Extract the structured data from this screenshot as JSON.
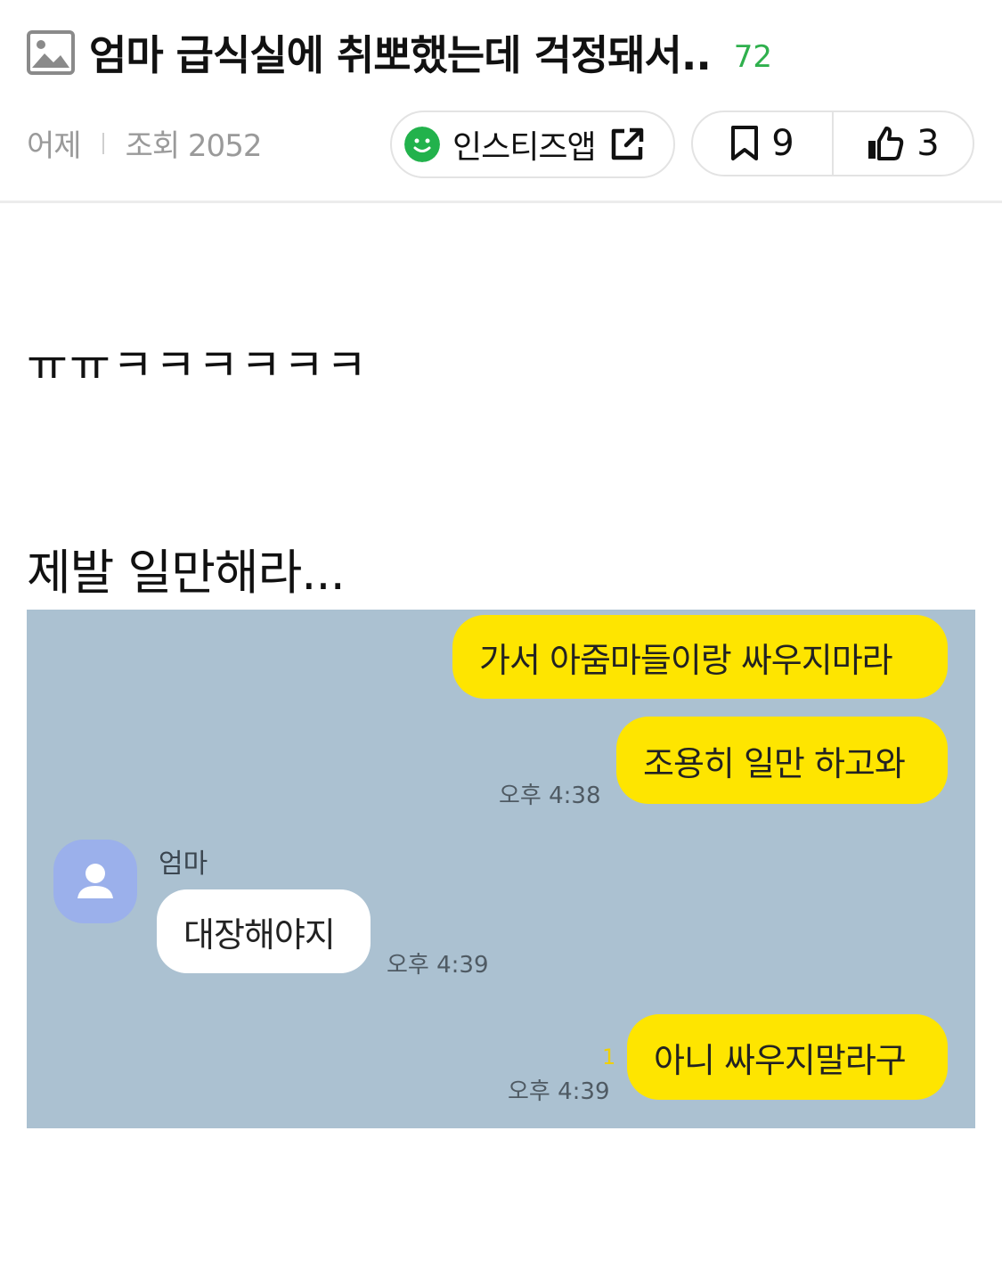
{
  "header": {
    "title": "엄마 급식실에 취뽀했는데 걱정돼서..",
    "comment_count": "72",
    "time": "어제",
    "views": "조회 2052",
    "app_button_label": "인스티즈앱",
    "bookmark_count": "9",
    "like_count": "3"
  },
  "post": {
    "line1": "ㅠㅠㅋㅋㅋㅋㅋㅋ",
    "line2": "제발 일만해라..."
  },
  "chat": {
    "messages": [
      {
        "text": "가서 아줌마들이랑 싸우지마라"
      },
      {
        "text": "조용히 일만 하고와",
        "time": "오후 4:38"
      },
      {
        "sender": "엄마",
        "text": "대장해야지",
        "time": "오후 4:39"
      },
      {
        "text": "아니 싸우지말라구",
        "time": "오후 4:39",
        "unread": "1"
      }
    ]
  },
  "colors": {
    "accent_green": "#2fb04d",
    "chat_background": "#abc1d1",
    "my_bubble": "#fee500",
    "their_bubble": "#ffffff",
    "avatar": "#9bb0eb"
  },
  "icons": [
    "image-icon",
    "smile-icon",
    "external-link-icon",
    "bookmark-icon",
    "thumbs-up-icon",
    "person-icon"
  ]
}
